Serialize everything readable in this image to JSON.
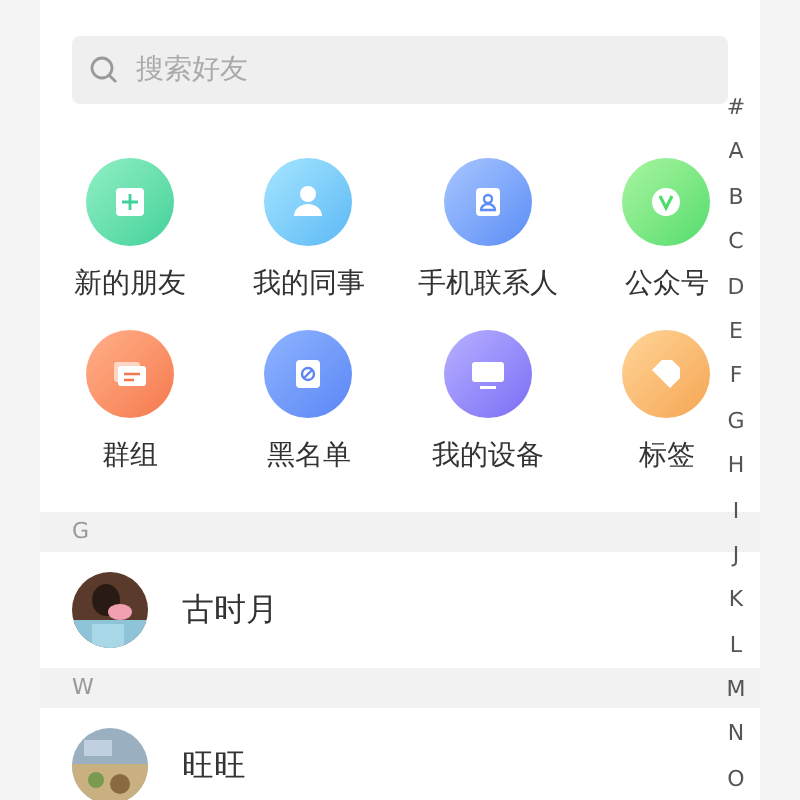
{
  "search": {
    "placeholder": "搜索好友"
  },
  "shortcuts": [
    {
      "label": "新的朋友"
    },
    {
      "label": "我的同事"
    },
    {
      "label": "手机联系人"
    },
    {
      "label": "公众号"
    },
    {
      "label": "群组"
    },
    {
      "label": "黑名单"
    },
    {
      "label": "我的设备"
    },
    {
      "label": "标签"
    }
  ],
  "index": [
    "#",
    "A",
    "B",
    "C",
    "D",
    "E",
    "F",
    "G",
    "H",
    "I",
    "J",
    "K",
    "L",
    "M",
    "N",
    "O"
  ],
  "sections": [
    {
      "letter": "G",
      "contacts": [
        {
          "name": "古时月"
        }
      ]
    },
    {
      "letter": "W",
      "contacts": [
        {
          "name": "旺旺"
        }
      ]
    }
  ]
}
